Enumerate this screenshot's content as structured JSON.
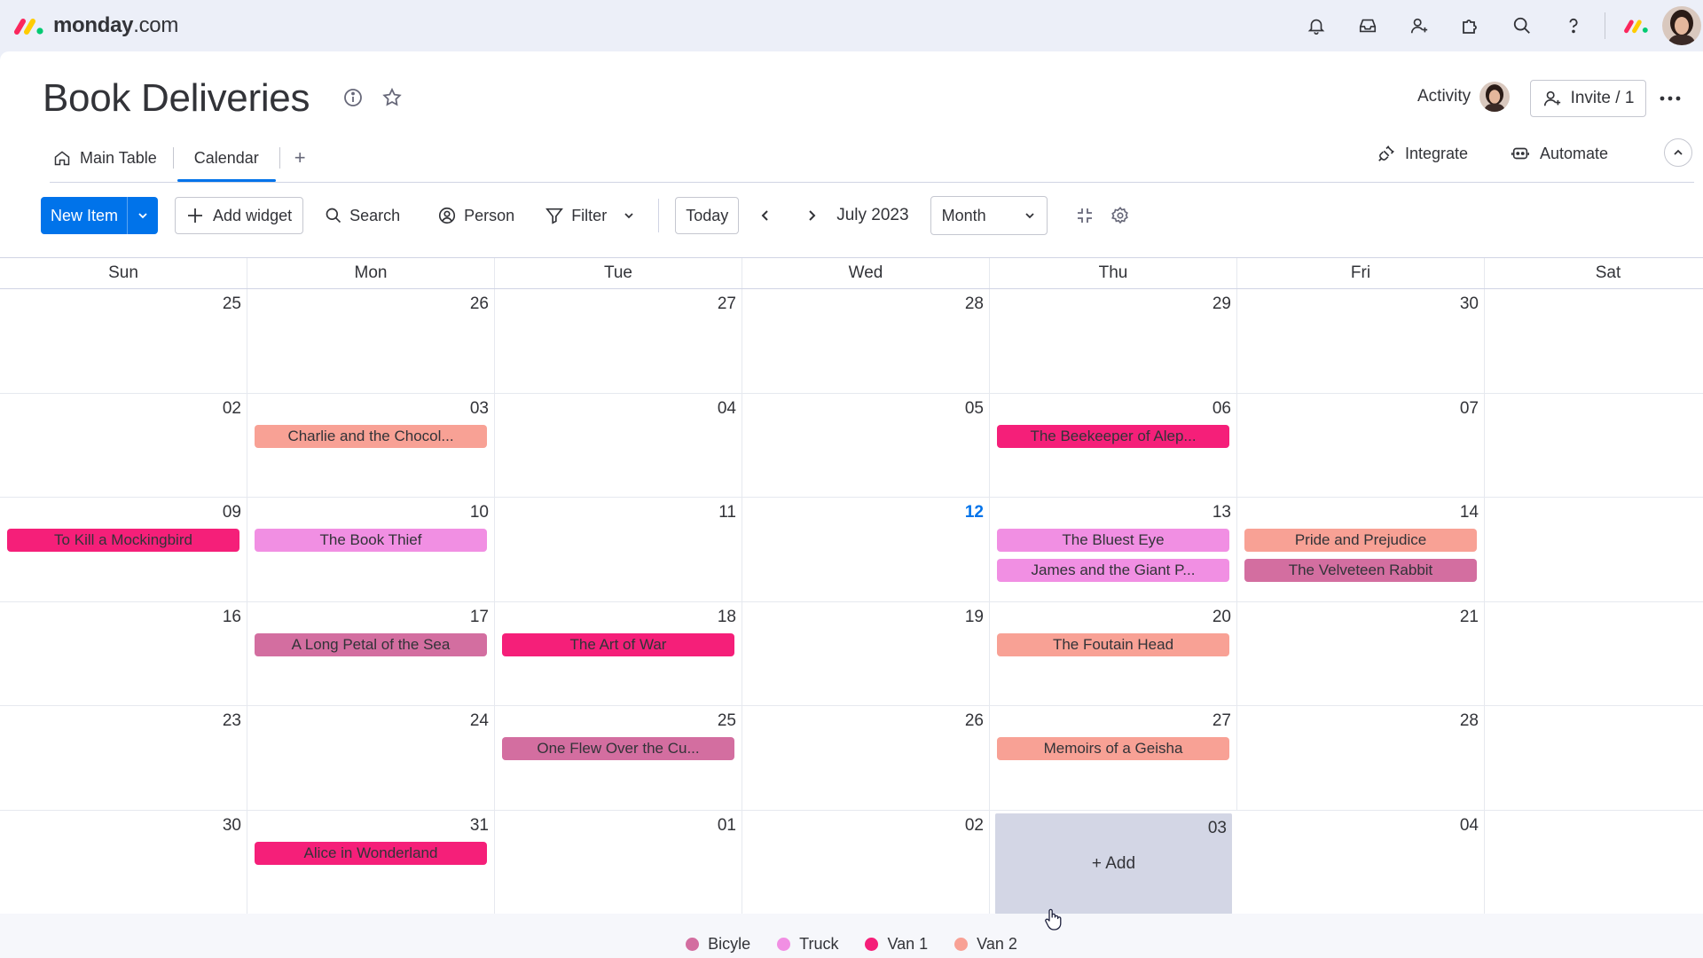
{
  "brand": {
    "name": "monday",
    "suffix": ".com"
  },
  "topbar": {
    "icons": [
      "bell-icon",
      "inbox-icon",
      "invite-members-icon",
      "apps-icon",
      "search-icon",
      "help-icon"
    ]
  },
  "board": {
    "title": "Book Deliveries",
    "activity_label": "Activity",
    "invite_label": "Invite / 1"
  },
  "tabs": [
    {
      "label": "Main Table",
      "active": false
    },
    {
      "label": "Calendar",
      "active": true
    }
  ],
  "tab_add": "+",
  "actions": {
    "integrate": "Integrate",
    "automate": "Automate"
  },
  "toolbar": {
    "new_item": "New Item",
    "add_widget": "Add widget",
    "search": "Search",
    "person": "Person",
    "filter": "Filter",
    "today": "Today",
    "period_label": "July 2023",
    "view_mode": "Month"
  },
  "calendar": {
    "weekdays": [
      "Sun",
      "Mon",
      "Tue",
      "Wed",
      "Thu",
      "Fri",
      "Sat"
    ],
    "today": "12",
    "hover_add_label": "+ Add",
    "weeks": [
      [
        {
          "d": "25"
        },
        {
          "d": "26"
        },
        {
          "d": "27"
        },
        {
          "d": "28"
        },
        {
          "d": "29"
        },
        {
          "d": "30"
        },
        {
          "d": ""
        }
      ],
      [
        {
          "d": "02"
        },
        {
          "d": "03",
          "events": [
            {
              "t": "Charlie and the Chocol...",
              "g": "Van 2"
            }
          ]
        },
        {
          "d": "04"
        },
        {
          "d": "05"
        },
        {
          "d": "06",
          "events": [
            {
              "t": "The Beekeeper of Alep...",
              "g": "Van 1"
            }
          ]
        },
        {
          "d": "07"
        },
        {
          "d": ""
        }
      ],
      [
        {
          "d": "09",
          "events": [
            {
              "t": "To Kill a Mockingbird",
              "g": "Van 1"
            }
          ]
        },
        {
          "d": "10",
          "events": [
            {
              "t": "The Book Thief",
              "g": "Truck"
            }
          ]
        },
        {
          "d": "11"
        },
        {
          "d": "12"
        },
        {
          "d": "13",
          "events": [
            {
              "t": "The Bluest Eye",
              "g": "Truck"
            },
            {
              "t": "James and the Giant P...",
              "g": "Truck"
            }
          ]
        },
        {
          "d": "14",
          "events": [
            {
              "t": "Pride and Prejudice",
              "g": "Van 2"
            },
            {
              "t": "The Velveteen Rabbit",
              "g": "Bicyle"
            }
          ]
        },
        {
          "d": ""
        }
      ],
      [
        {
          "d": "16"
        },
        {
          "d": "17",
          "events": [
            {
              "t": "A Long Petal of the Sea",
              "g": "Bicyle"
            }
          ]
        },
        {
          "d": "18",
          "events": [
            {
              "t": "The Art of War",
              "g": "Van 1"
            }
          ]
        },
        {
          "d": "19"
        },
        {
          "d": "20",
          "events": [
            {
              "t": "The Foutain Head",
              "g": "Van 2"
            }
          ]
        },
        {
          "d": "21"
        },
        {
          "d": ""
        }
      ],
      [
        {
          "d": "23"
        },
        {
          "d": "24"
        },
        {
          "d": "25",
          "events": [
            {
              "t": "One Flew Over the Cu...",
              "g": "Bicyle"
            }
          ]
        },
        {
          "d": "26"
        },
        {
          "d": "27",
          "events": [
            {
              "t": "Memoirs of a Geisha",
              "g": "Van 2"
            }
          ]
        },
        {
          "d": "28"
        },
        {
          "d": ""
        }
      ],
      [
        {
          "d": "30"
        },
        {
          "d": "31",
          "events": [
            {
              "t": "Alice in Wonderland",
              "g": "Van 1"
            }
          ]
        },
        {
          "d": "01"
        },
        {
          "d": "02"
        },
        {
          "d": "03",
          "hover": true
        },
        {
          "d": "04"
        },
        {
          "d": ""
        }
      ]
    ]
  },
  "legend": [
    {
      "label": "Bicyle",
      "color": "#d36ea0"
    },
    {
      "label": "Truck",
      "color": "#f18fe3"
    },
    {
      "label": "Van 1",
      "color": "#f51f79"
    },
    {
      "label": "Van 2",
      "color": "#f8a195"
    }
  ]
}
